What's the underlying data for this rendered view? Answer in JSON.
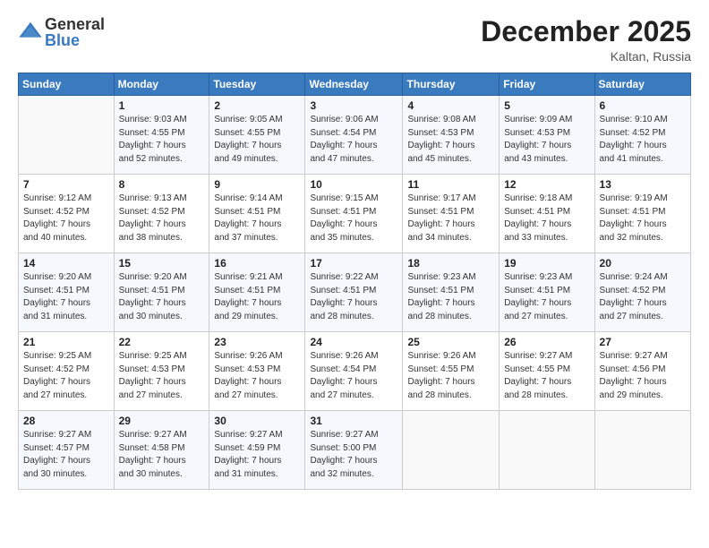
{
  "logo": {
    "general": "General",
    "blue": "Blue"
  },
  "header": {
    "month": "December 2025",
    "location": "Kaltan, Russia"
  },
  "days_of_week": [
    "Sunday",
    "Monday",
    "Tuesday",
    "Wednesday",
    "Thursday",
    "Friday",
    "Saturday"
  ],
  "weeks": [
    [
      {
        "day": "",
        "info": ""
      },
      {
        "day": "1",
        "info": "Sunrise: 9:03 AM\nSunset: 4:55 PM\nDaylight: 7 hours\nand 52 minutes."
      },
      {
        "day": "2",
        "info": "Sunrise: 9:05 AM\nSunset: 4:55 PM\nDaylight: 7 hours\nand 49 minutes."
      },
      {
        "day": "3",
        "info": "Sunrise: 9:06 AM\nSunset: 4:54 PM\nDaylight: 7 hours\nand 47 minutes."
      },
      {
        "day": "4",
        "info": "Sunrise: 9:08 AM\nSunset: 4:53 PM\nDaylight: 7 hours\nand 45 minutes."
      },
      {
        "day": "5",
        "info": "Sunrise: 9:09 AM\nSunset: 4:53 PM\nDaylight: 7 hours\nand 43 minutes."
      },
      {
        "day": "6",
        "info": "Sunrise: 9:10 AM\nSunset: 4:52 PM\nDaylight: 7 hours\nand 41 minutes."
      }
    ],
    [
      {
        "day": "7",
        "info": "Sunrise: 9:12 AM\nSunset: 4:52 PM\nDaylight: 7 hours\nand 40 minutes."
      },
      {
        "day": "8",
        "info": "Sunrise: 9:13 AM\nSunset: 4:52 PM\nDaylight: 7 hours\nand 38 minutes."
      },
      {
        "day": "9",
        "info": "Sunrise: 9:14 AM\nSunset: 4:51 PM\nDaylight: 7 hours\nand 37 minutes."
      },
      {
        "day": "10",
        "info": "Sunrise: 9:15 AM\nSunset: 4:51 PM\nDaylight: 7 hours\nand 35 minutes."
      },
      {
        "day": "11",
        "info": "Sunrise: 9:17 AM\nSunset: 4:51 PM\nDaylight: 7 hours\nand 34 minutes."
      },
      {
        "day": "12",
        "info": "Sunrise: 9:18 AM\nSunset: 4:51 PM\nDaylight: 7 hours\nand 33 minutes."
      },
      {
        "day": "13",
        "info": "Sunrise: 9:19 AM\nSunset: 4:51 PM\nDaylight: 7 hours\nand 32 minutes."
      }
    ],
    [
      {
        "day": "14",
        "info": "Sunrise: 9:20 AM\nSunset: 4:51 PM\nDaylight: 7 hours\nand 31 minutes."
      },
      {
        "day": "15",
        "info": "Sunrise: 9:20 AM\nSunset: 4:51 PM\nDaylight: 7 hours\nand 30 minutes."
      },
      {
        "day": "16",
        "info": "Sunrise: 9:21 AM\nSunset: 4:51 PM\nDaylight: 7 hours\nand 29 minutes."
      },
      {
        "day": "17",
        "info": "Sunrise: 9:22 AM\nSunset: 4:51 PM\nDaylight: 7 hours\nand 28 minutes."
      },
      {
        "day": "18",
        "info": "Sunrise: 9:23 AM\nSunset: 4:51 PM\nDaylight: 7 hours\nand 28 minutes."
      },
      {
        "day": "19",
        "info": "Sunrise: 9:23 AM\nSunset: 4:51 PM\nDaylight: 7 hours\nand 27 minutes."
      },
      {
        "day": "20",
        "info": "Sunrise: 9:24 AM\nSunset: 4:52 PM\nDaylight: 7 hours\nand 27 minutes."
      }
    ],
    [
      {
        "day": "21",
        "info": "Sunrise: 9:25 AM\nSunset: 4:52 PM\nDaylight: 7 hours\nand 27 minutes."
      },
      {
        "day": "22",
        "info": "Sunrise: 9:25 AM\nSunset: 4:53 PM\nDaylight: 7 hours\nand 27 minutes."
      },
      {
        "day": "23",
        "info": "Sunrise: 9:26 AM\nSunset: 4:53 PM\nDaylight: 7 hours\nand 27 minutes."
      },
      {
        "day": "24",
        "info": "Sunrise: 9:26 AM\nSunset: 4:54 PM\nDaylight: 7 hours\nand 27 minutes."
      },
      {
        "day": "25",
        "info": "Sunrise: 9:26 AM\nSunset: 4:55 PM\nDaylight: 7 hours\nand 28 minutes."
      },
      {
        "day": "26",
        "info": "Sunrise: 9:27 AM\nSunset: 4:55 PM\nDaylight: 7 hours\nand 28 minutes."
      },
      {
        "day": "27",
        "info": "Sunrise: 9:27 AM\nSunset: 4:56 PM\nDaylight: 7 hours\nand 29 minutes."
      }
    ],
    [
      {
        "day": "28",
        "info": "Sunrise: 9:27 AM\nSunset: 4:57 PM\nDaylight: 7 hours\nand 30 minutes."
      },
      {
        "day": "29",
        "info": "Sunrise: 9:27 AM\nSunset: 4:58 PM\nDaylight: 7 hours\nand 30 minutes."
      },
      {
        "day": "30",
        "info": "Sunrise: 9:27 AM\nSunset: 4:59 PM\nDaylight: 7 hours\nand 31 minutes."
      },
      {
        "day": "31",
        "info": "Sunrise: 9:27 AM\nSunset: 5:00 PM\nDaylight: 7 hours\nand 32 minutes."
      },
      {
        "day": "",
        "info": ""
      },
      {
        "day": "",
        "info": ""
      },
      {
        "day": "",
        "info": ""
      }
    ]
  ]
}
